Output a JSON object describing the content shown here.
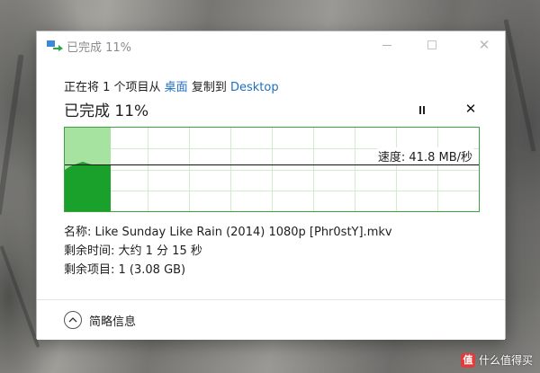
{
  "dialog": {
    "title": "已完成 11%",
    "description_prefix": "正在将 1 个项目从 ",
    "source": "桌面",
    "description_middle": " 复制到 ",
    "destination": "Desktop",
    "heading": "已完成 11%",
    "progress": 0.11,
    "speed_label": "速度: 41.8 MB/秒",
    "details": {
      "name_row": "名称: Like Sunday Like Rain (2014) 1080p [Phr0stY].mkv",
      "time_row": "剩余时间: 大约 1 分 15 秒",
      "items_row": "剩余项目: 1 (3.08 GB)"
    },
    "toggle_label": "简略信息"
  },
  "watermark": {
    "badge": "值",
    "text": "什么值得买"
  },
  "colors": {
    "accent_link": "#1f6fc1",
    "graph_fill_dark": "#1aa12c",
    "graph_fill_light": "#a6e3a0",
    "graph_grid": "#cfeccc"
  }
}
